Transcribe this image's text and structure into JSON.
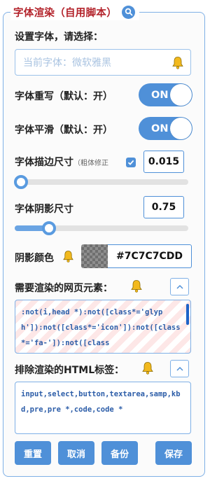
{
  "header": {
    "title": "字体渲染（自用脚本）",
    "icon": "search-icon"
  },
  "font_setting": {
    "label": "设置字体，请选择：",
    "placeholder": "当前字体：微软雅黑",
    "icon": "bell-icon"
  },
  "font_rewrite": {
    "label": "字体重写（默认：开）",
    "toggle_text": "ON",
    "on": true
  },
  "font_smooth": {
    "label": "字体平滑（默认：开）",
    "toggle_text": "ON",
    "on": true
  },
  "stroke": {
    "label": "字体描边尺寸",
    "note": "（粗体修正",
    "checked": true,
    "value": "0.015",
    "slider_fraction": 0.0
  },
  "shadow_size": {
    "label": "字体阴影尺寸",
    "value": "0.75",
    "slider_fraction": 0.19
  },
  "shadow_color": {
    "label": "阴影颜色",
    "value": "#7C7C7CDD",
    "icon": "bell-icon"
  },
  "render_elements": {
    "label": "需要渲染的网页元素：",
    "icon": "bell-icon",
    "collapse_icon": "chevron-up-icon",
    "value": ":not(i,head *):not([class*='glyph']):not([class*='icon']):not([class*='fa-']):not([class"
  },
  "exclude_tags": {
    "label": "排除渲染的HTML标签：",
    "icon": "bell-icon",
    "collapse_icon": "chevron-up-icon",
    "value": "input,select,button,textarea,samp,kbd,pre,pre *,code,code *"
  },
  "buttons": {
    "reset": "重置",
    "cancel": "取消",
    "backup": "备份",
    "save": "保存"
  },
  "colors": {
    "accent": "#4f90d8",
    "title": "#b3232b",
    "bell": "#f2b91e"
  }
}
